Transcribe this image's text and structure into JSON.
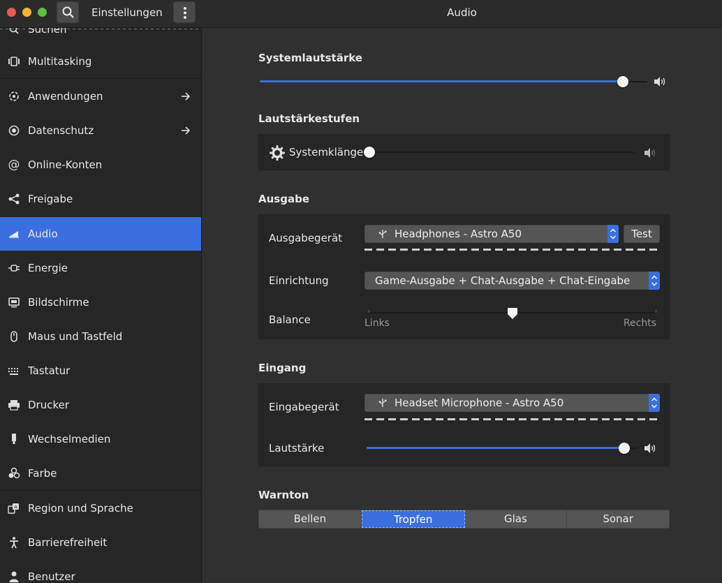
{
  "window": {
    "app_title": "Einstellungen",
    "title": "Audio"
  },
  "sidebar": {
    "search_partial": "Suchen",
    "items": [
      {
        "label": "Multitasking",
        "icon": "multitasking-icon",
        "arrow": false
      },
      {
        "label": "Anwendungen",
        "icon": "applications-icon",
        "arrow": true
      },
      {
        "label": "Datenschutz",
        "icon": "privacy-icon",
        "arrow": true
      },
      {
        "label": "Online-Konten",
        "icon": "at-icon",
        "arrow": false
      },
      {
        "label": "Freigabe",
        "icon": "share-icon",
        "arrow": false
      },
      {
        "label": "Audio",
        "icon": "speaker-icon",
        "arrow": false,
        "active": true
      },
      {
        "label": "Energie",
        "icon": "power-plug-icon",
        "arrow": false
      },
      {
        "label": "Bildschirme",
        "icon": "display-icon",
        "arrow": false
      },
      {
        "label": "Maus und Tastfeld",
        "icon": "mouse-icon",
        "arrow": false
      },
      {
        "label": "Tastatur",
        "icon": "keyboard-icon",
        "arrow": false
      },
      {
        "label": "Drucker",
        "icon": "printer-icon",
        "arrow": false
      },
      {
        "label": "Wechselmedien",
        "icon": "usb-stick-icon",
        "arrow": false
      },
      {
        "label": "Farbe",
        "icon": "color-icon",
        "arrow": false
      },
      {
        "label": "Region und Sprache",
        "icon": "region-icon",
        "arrow": false
      },
      {
        "label": "Barrierefreiheit",
        "icon": "accessibility-icon",
        "arrow": false
      },
      {
        "label": "Benutzer",
        "icon": "user-icon",
        "arrow": false
      }
    ]
  },
  "system_volume": {
    "heading": "Systemlautstärke",
    "level": 0.95
  },
  "volume_levels": {
    "heading": "Lautstärkestufen",
    "system_sounds_label": "Systemklänge",
    "level": 0.0
  },
  "output": {
    "heading": "Ausgabe",
    "device_label": "Ausgabegerät",
    "device_value": "Headphones - Astro A50",
    "test_label": "Test",
    "config_label": "Einrichtung",
    "config_value": "Game-Ausgabe + Chat-Ausgabe + Chat-Eingabe",
    "balance_label": "Balance",
    "balance_left": "Links",
    "balance_right": "Rechts",
    "balance": 0.5
  },
  "input": {
    "heading": "Eingang",
    "device_label": "Eingabegerät",
    "device_value": "Headset Microphone - Astro A50",
    "volume_label": "Lautstärke",
    "level": 0.97
  },
  "alert_sound": {
    "heading": "Warnton",
    "options": [
      "Bellen",
      "Tropfen",
      "Glas",
      "Sonar"
    ],
    "selected": "Tropfen"
  },
  "colors": {
    "accent": "#3b6fe0",
    "sidebar_bg": "#262626",
    "content_bg": "#303030"
  }
}
